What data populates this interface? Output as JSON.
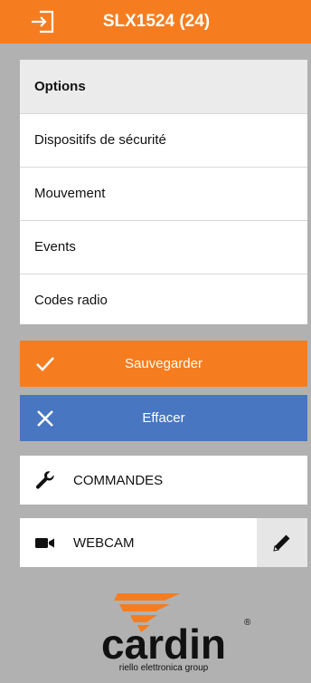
{
  "header": {
    "title": "SLX1524 (24)",
    "icon": "login-icon"
  },
  "menu": {
    "heading": "Options",
    "items": [
      {
        "label": "Dispositifs de sécurité"
      },
      {
        "label": "Mouvement"
      },
      {
        "label": "Events"
      },
      {
        "label": "Codes radio"
      }
    ]
  },
  "actions": {
    "save_label": "Sauvegarder",
    "clear_label": "Effacer"
  },
  "rows": {
    "commands_label": "COMMANDES",
    "webcam_label": "WEBCAM"
  },
  "brand": {
    "name": "cardin",
    "tagline": "riello elettronica group"
  },
  "colors": {
    "accent_orange": "#f57d20",
    "clear_blue": "#4876c0",
    "background": "#b1b1b1"
  }
}
